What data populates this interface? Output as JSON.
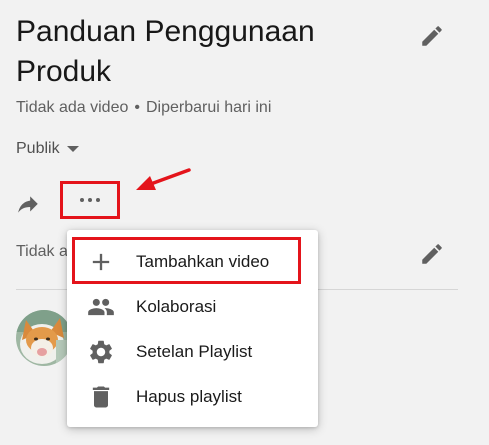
{
  "playlist": {
    "title": "Panduan Penggunaan Produk",
    "video_count": "Tidak ada video",
    "separator": "•",
    "updated": "Diperbarui hari ini",
    "privacy": "Publik",
    "description": "Tidak a"
  },
  "icons": {
    "title_edit": "pencil-icon",
    "desc_edit": "pencil-icon",
    "share": "share-arrow-icon",
    "more": "more-horizontal-icon",
    "privacy_dropdown": "caret-down-icon",
    "avatar": "cat-avatar"
  },
  "menu": {
    "items": [
      {
        "label": "Tambahkan video",
        "icon": "plus-icon"
      },
      {
        "label": "Kolaborasi",
        "icon": "people-icon"
      },
      {
        "label": "Setelan Playlist",
        "icon": "gear-icon"
      },
      {
        "label": "Hapus playlist",
        "icon": "trash-icon"
      }
    ]
  },
  "colors": {
    "annotation_red": "#e4141b",
    "icon_gray": "#606060",
    "background": "#f2f2f2"
  }
}
